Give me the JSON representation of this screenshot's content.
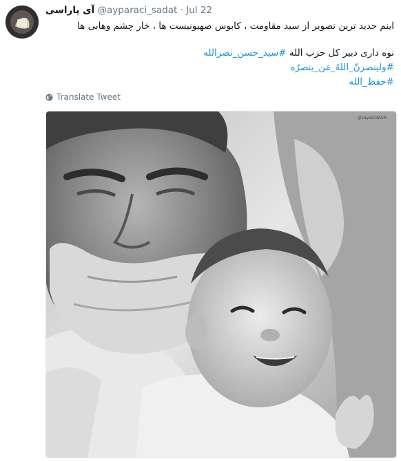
{
  "tweet": {
    "author": {
      "fullname": "آی پاراسی",
      "username": "@ayparaci_sadat",
      "separator": "·",
      "time": "Jul 22"
    },
    "text": {
      "line1": "اینم جدید ترین تصویر از سید مقاومت ، کابوس صهیونیست ها ، خار چشم وهابی ها",
      "line2_prefix": "نوه داری دبیر کل حزب الله ",
      "hashtags": [
        "#سید_حسن_نصرالله",
        "#ولینصرنّ_اللهُ_مَن_ینصرُه",
        "#حفظ_الله"
      ]
    },
    "translate_label": "Translate Tweet",
    "media": {
      "watermark": "@sayed.NASR"
    }
  },
  "icons": {
    "avatar": "profile-avatar",
    "translate": "globe-icon"
  }
}
